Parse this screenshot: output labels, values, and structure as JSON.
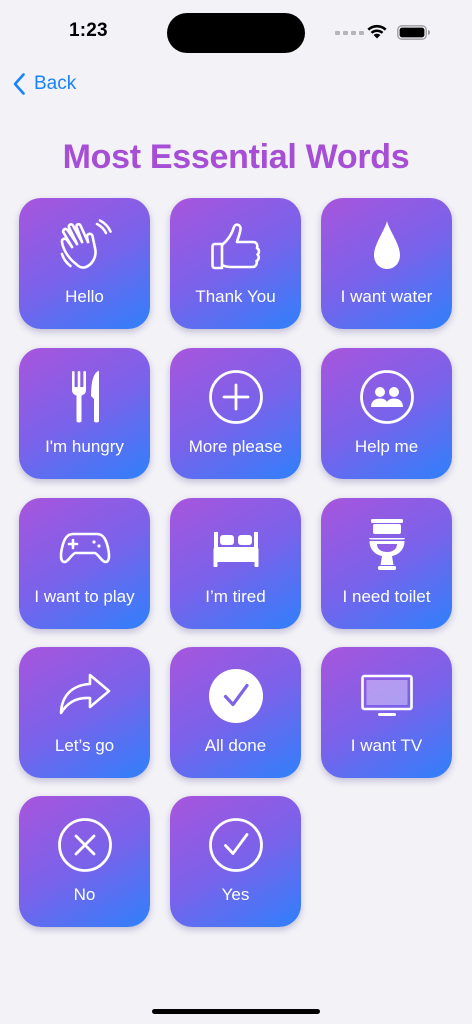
{
  "status_bar": {
    "time": "1:23"
  },
  "nav": {
    "back_label": "Back"
  },
  "page": {
    "title": "Most Essential Words",
    "title_color": "#a64fd6",
    "tile_gradient": [
      "#a855dc",
      "#2f80fb"
    ],
    "accent_color": "#1a82ff"
  },
  "tiles": [
    {
      "label": "Hello",
      "icon": "waving-hand-icon"
    },
    {
      "label": "Thank You",
      "icon": "thumbs-up-icon"
    },
    {
      "label": "I want water",
      "icon": "water-drop-icon"
    },
    {
      "label": "I'm hungry",
      "icon": "fork-knife-icon"
    },
    {
      "label": "More please",
      "icon": "plus-circle-icon"
    },
    {
      "label": "Help me",
      "icon": "people-circle-icon"
    },
    {
      "label": "I want to play",
      "icon": "game-controller-icon"
    },
    {
      "label": "I’m tired",
      "icon": "bed-icon"
    },
    {
      "label": "I need toilet",
      "icon": "toilet-icon"
    },
    {
      "label": "Let’s go",
      "icon": "arrow-forward-icon"
    },
    {
      "label": "All done",
      "icon": "checkmark-circle-filled-icon"
    },
    {
      "label": "I want TV",
      "icon": "tv-icon"
    },
    {
      "label": "No",
      "icon": "x-circle-icon"
    },
    {
      "label": "Yes",
      "icon": "checkmark-circle-icon"
    }
  ]
}
